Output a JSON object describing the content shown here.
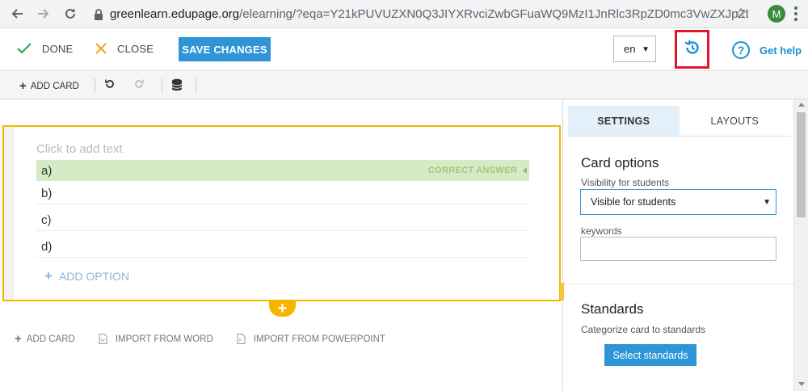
{
  "browser": {
    "url_host": "greenlearn.edupage.org",
    "url_path": "/elearning/?eqa=Y21kPUVUZXN0Q3JIYXRvciZwbGFuaWQ9MzI1JnRlc3RpZD0mc3VwZXJpZD0mY...",
    "avatar_letter": "M"
  },
  "toolbar": {
    "done_label": "DONE",
    "close_label": "CLOSE",
    "save_label": "SAVE CHANGES",
    "language": "en",
    "help_label": "Get help"
  },
  "subbar": {
    "add_card_label": "ADD CARD"
  },
  "card": {
    "placeholder": "Click to add text",
    "correct_answer_label": "CORRECT ANSWER",
    "options": [
      {
        "label": "a)"
      },
      {
        "label": "b)"
      },
      {
        "label": "c)"
      },
      {
        "label": "d)"
      }
    ],
    "add_option_label": "ADD OPTION"
  },
  "bottom": {
    "add_card_label": "ADD CARD",
    "import_word_label": "IMPORT FROM WORD",
    "import_ppt_label": "IMPORT FROM POWERPOINT"
  },
  "panel": {
    "tabs": [
      {
        "label": "SETTINGS",
        "active": true
      },
      {
        "label": "LAYOUTS",
        "active": false
      }
    ],
    "card_options_title": "Card options",
    "visibility_label": "Visibility for students",
    "visibility_value": "Visible for students",
    "keywords_label": "keywords",
    "keywords_value": "",
    "standards_title": "Standards",
    "standards_desc": "Categorize card to standards",
    "select_standards_label": "Select standards"
  },
  "colors": {
    "accent": "#2f95d7",
    "card_border": "#f5b400",
    "correct_bg": "#d6eac6",
    "highlight": "#e0172a"
  }
}
